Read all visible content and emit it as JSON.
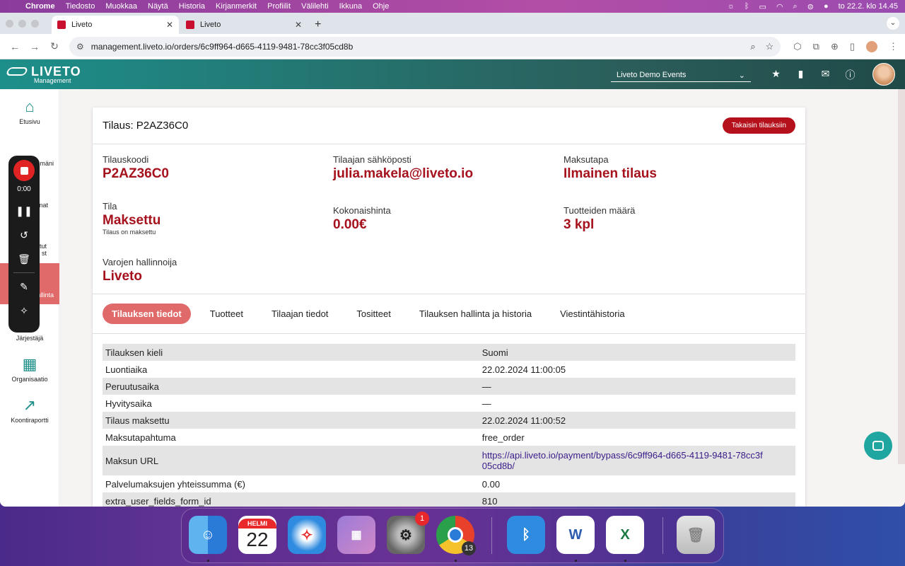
{
  "menubar": {
    "items": [
      "Chrome",
      "Tiedosto",
      "Muokkaa",
      "Näytä",
      "Historia",
      "Kirjanmerkit",
      "Profiilit",
      "Välilehti",
      "Ikkuna",
      "Ohje"
    ],
    "clock": "to 22.2. klo 14.45"
  },
  "browser": {
    "tabs": [
      {
        "title": "Liveto"
      },
      {
        "title": "Liveto"
      }
    ],
    "url": "management.liveto.io/orders/6c9ff964-d665-4119-9481-78cc3f05cd8b"
  },
  "app": {
    "logo": "LIVETO",
    "logo_sub": "Management",
    "event_selector": "Liveto Demo Events"
  },
  "sidebar": {
    "items": [
      {
        "label": "Etusivu"
      },
      {
        "label": "mäni"
      },
      {
        "label": "nat"
      },
      {
        "label": "tut"
      },
      {
        "label": "st"
      },
      {
        "label": "hallinta"
      },
      {
        "label": "Järjestäjä"
      },
      {
        "label": "Organisaatio"
      },
      {
        "label": "Koontiraportti"
      }
    ]
  },
  "recorder": {
    "time": "0:00"
  },
  "order": {
    "title": "Tilaus: P2AZ36C0",
    "back_button": "Takaisin tilauksiin",
    "fields": {
      "code_label": "Tilauskoodi",
      "code_value": "P2AZ36C0",
      "email_label": "Tilaajan sähköposti",
      "email_value": "julia.makela@liveto.io",
      "payment_label": "Maksutapa",
      "payment_value": "Ilmainen tilaus",
      "status_label": "Tila",
      "status_value": "Maksettu",
      "status_note": "Tilaus on maksettu",
      "total_label": "Kokonaishinta",
      "total_value": "0.00€",
      "qty_label": "Tuotteiden määrä",
      "qty_value": "3 kpl",
      "custodian_label": "Varojen hallinnoija",
      "custodian_value": "Liveto"
    },
    "tabs": [
      "Tilauksen tiedot",
      "Tuotteet",
      "Tilaajan tiedot",
      "Tositteet",
      "Tilauksen hallinta ja historia",
      "Viestintähistoria"
    ],
    "details": [
      {
        "k": "Tilauksen kieli",
        "v": "Suomi"
      },
      {
        "k": "Luontiaika",
        "v": "22.02.2024 11:00:05"
      },
      {
        "k": "Peruutusaika",
        "v": "—"
      },
      {
        "k": "Hyvitysaika",
        "v": "—"
      },
      {
        "k": "Tilaus maksettu",
        "v": "22.02.2024 11:00:52"
      },
      {
        "k": "Maksutapahtuma",
        "v": "free_order"
      },
      {
        "k": "Maksun URL",
        "v": "https://api.liveto.io/payment/bypass/6c9ff964-d665-4119-9481-78cc3f05cd8b/"
      },
      {
        "k": "Palvelumaksujen yhteissumma (€)",
        "v": "0.00"
      },
      {
        "k": "extra_user_fields_form_id",
        "v": "810"
      }
    ]
  },
  "dock": {
    "calendar_month": "HELMI",
    "calendar_day": "22",
    "settings_badge": "1",
    "chrome_badge": "13"
  }
}
